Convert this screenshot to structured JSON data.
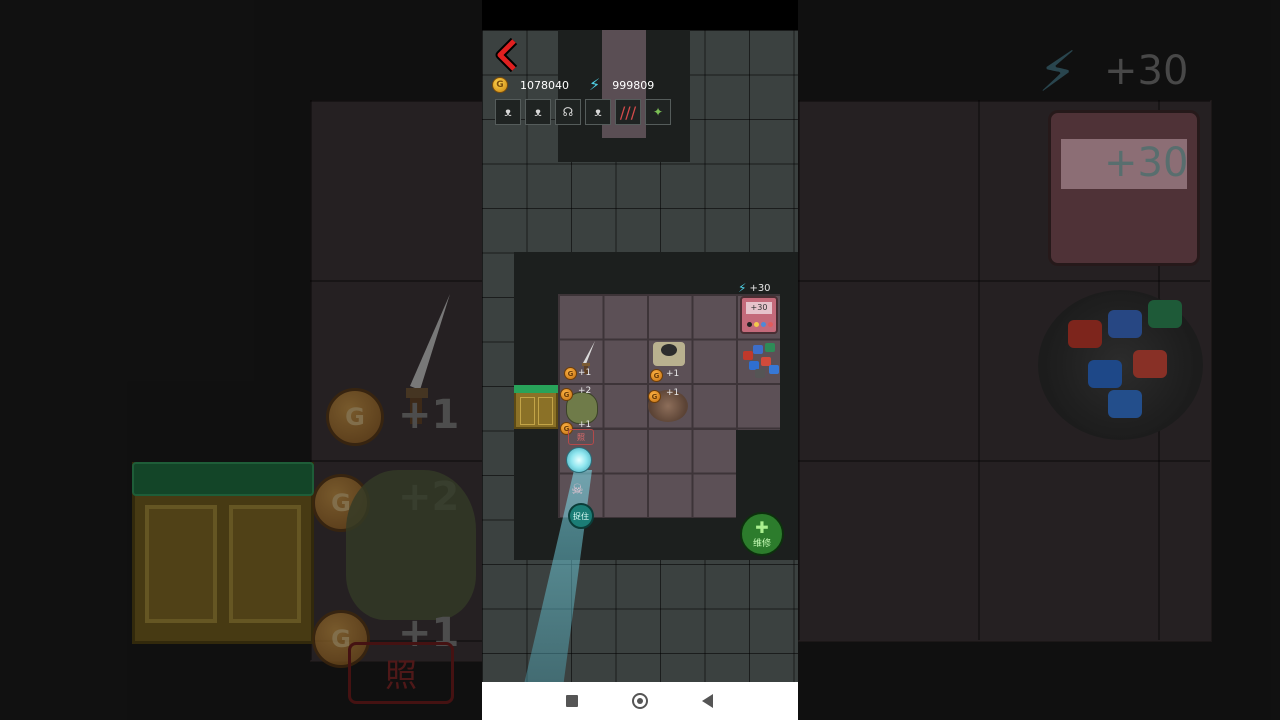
{
  "hud": {
    "gold_value": "1078040",
    "energy_value": "999809",
    "coin_letter": "G",
    "bolt_icon": "⚡"
  },
  "skills": [
    {
      "name": "skill-bat-1",
      "glyph": "ᴥ"
    },
    {
      "name": "skill-bat-2",
      "glyph": "ᴥ"
    },
    {
      "name": "skill-headphones",
      "glyph": "☊"
    },
    {
      "name": "skill-bat-3",
      "glyph": "ᴥ"
    },
    {
      "name": "skill-claw",
      "glyph": "///"
    },
    {
      "name": "skill-fish",
      "glyph": "✦"
    }
  ],
  "map": {
    "energy_bonus": "+30",
    "machine_screen": "+30",
    "sword_coin_plus": "+1",
    "cat_coin_plus": "+2",
    "cat_coin2_plus": "+1",
    "bed_coin_plus": "+1",
    "nest_coin_plus": "+1",
    "stamp_label": "照",
    "catch_label": "捉住",
    "repair_label": "维修"
  },
  "side": {
    "big_plus_1": "+1",
    "big_plus_2": "+2",
    "big_plus_3": "+1",
    "big_stamp": "照",
    "big_energy_1": "+30",
    "big_energy_2": "+30"
  },
  "colors": {
    "back_arrow": "#e02020",
    "energy": "#4fd1e6",
    "repair_button": "#2c7c2c",
    "catch_button": "#1b7d76"
  }
}
